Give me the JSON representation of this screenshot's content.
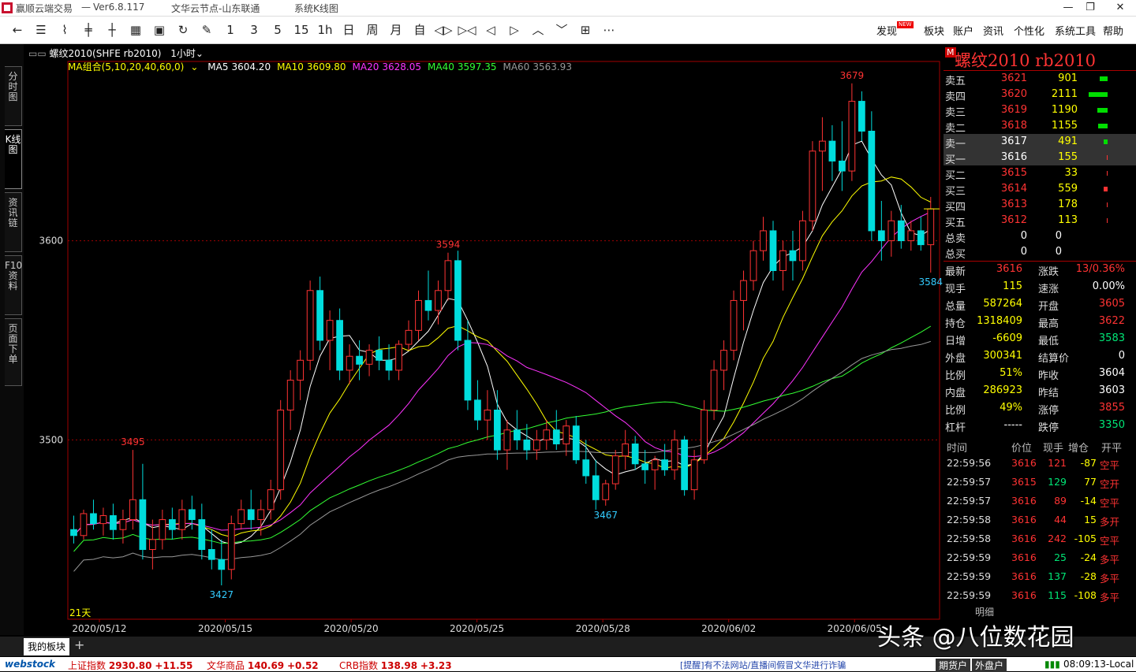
{
  "window": {
    "app_title": "赢顺云端交易",
    "version": "Ver6.8.117",
    "node": "文华云节点-山东联通",
    "chart_mode": "系统K线图",
    "buttons": {
      "minimize": "—",
      "restore": "❐",
      "close": "✕"
    }
  },
  "toolbar": {
    "icons": [
      "back-arrow-icon",
      "list-icon",
      "line-chart-icon",
      "candle-icon",
      "kline-icon",
      "table-icon",
      "save-icon",
      "refresh-icon",
      "draw-icon",
      "period-1",
      "period-3",
      "period-5",
      "period-15",
      "period-1h",
      "period-day",
      "period-week",
      "period-month",
      "custom-period",
      "zoom-in-icon",
      "zoom-out-icon",
      "left-icon",
      "right-icon",
      "up-icon",
      "down-icon",
      "layout-icon",
      "more-icon"
    ],
    "period_labels": [
      "1",
      "3",
      "5",
      "15",
      "1h",
      "日",
      "周",
      "月",
      "自"
    ],
    "more": "⋯",
    "menu": [
      "发现",
      "板块",
      "账户",
      "资讯",
      "个性化",
      "系统工具",
      "帮助"
    ],
    "new_badge": "NEW"
  },
  "side_tabs": [
    "分时图",
    "K线图",
    "资讯链",
    "F10资料",
    "页面下单"
  ],
  "chart_header": {
    "text": "螺纹2010(SHFE rb2010)",
    "period": "1小时",
    "ma_group_label": "MA组合(5,10,20,40,60,0)",
    "ma": [
      {
        "label": "MA5",
        "value": "3604.20",
        "color": "#ffffff"
      },
      {
        "label": "MA10",
        "value": "3609.80",
        "color": "#ffff00"
      },
      {
        "label": "MA20",
        "value": "3628.05",
        "color": "#ff33ff"
      },
      {
        "label": "MA40",
        "value": "3597.35",
        "color": "#33ff33"
      },
      {
        "label": "MA60",
        "value": "3563.93",
        "color": "#999999"
      }
    ],
    "days_label": "21天"
  },
  "chart_data": {
    "type": "candlestick",
    "ylim": [
      3410,
      3690
    ],
    "y_ticks": [
      3500,
      3600
    ],
    "x_ticks": [
      "2020/05/12",
      "2020/05/15",
      "2020/05/20",
      "2020/05/25",
      "2020/05/28",
      "2020/06/02",
      "2020/06/05"
    ],
    "annotations": [
      {
        "label": "3495",
        "value": 3495,
        "bar": 6
      },
      {
        "label": "3427",
        "value": 3427,
        "bar": 15
      },
      {
        "label": "3594",
        "value": 3594,
        "bar": 38
      },
      {
        "label": "3467",
        "value": 3467,
        "bar": 54
      },
      {
        "label": "3679",
        "value": 3679,
        "bar": 79
      },
      {
        "label": "3584",
        "value": 3584,
        "bar": 87
      }
    ],
    "candles": [
      [
        3455,
        3462,
        3448,
        3452
      ],
      [
        3452,
        3465,
        3450,
        3463
      ],
      [
        3463,
        3470,
        3455,
        3458
      ],
      [
        3458,
        3466,
        3452,
        3462
      ],
      [
        3462,
        3468,
        3450,
        3455
      ],
      [
        3455,
        3465,
        3448,
        3460
      ],
      [
        3460,
        3495,
        3455,
        3470
      ],
      [
        3470,
        3488,
        3440,
        3445
      ],
      [
        3445,
        3460,
        3435,
        3450
      ],
      [
        3450,
        3465,
        3445,
        3460
      ],
      [
        3460,
        3466,
        3450,
        3455
      ],
      [
        3455,
        3470,
        3450,
        3465
      ],
      [
        3465,
        3472,
        3455,
        3460
      ],
      [
        3460,
        3468,
        3440,
        3445
      ],
      [
        3445,
        3455,
        3435,
        3440
      ],
      [
        3440,
        3450,
        3427,
        3435
      ],
      [
        3435,
        3462,
        3430,
        3458
      ],
      [
        3458,
        3470,
        3455,
        3465
      ],
      [
        3465,
        3475,
        3455,
        3460
      ],
      [
        3460,
        3470,
        3452,
        3465
      ],
      [
        3465,
        3480,
        3460,
        3475
      ],
      [
        3475,
        3520,
        3470,
        3515
      ],
      [
        3515,
        3535,
        3505,
        3530
      ],
      [
        3530,
        3545,
        3520,
        3540
      ],
      [
        3540,
        3580,
        3535,
        3575
      ],
      [
        3575,
        3582,
        3545,
        3550
      ],
      [
        3550,
        3565,
        3535,
        3560
      ],
      [
        3560,
        3566,
        3530,
        3535
      ],
      [
        3535,
        3548,
        3528,
        3542
      ],
      [
        3542,
        3550,
        3530,
        3538
      ],
      [
        3538,
        3548,
        3532,
        3545
      ],
      [
        3545,
        3552,
        3535,
        3540
      ],
      [
        3540,
        3548,
        3530,
        3535
      ],
      [
        3535,
        3550,
        3530,
        3548
      ],
      [
        3548,
        3560,
        3545,
        3555
      ],
      [
        3555,
        3575,
        3550,
        3570
      ],
      [
        3570,
        3585,
        3560,
        3565
      ],
      [
        3565,
        3580,
        3558,
        3575
      ],
      [
        3575,
        3594,
        3570,
        3590
      ],
      [
        3590,
        3595,
        3545,
        3550
      ],
      [
        3550,
        3560,
        3515,
        3520
      ],
      [
        3520,
        3530,
        3505,
        3510
      ],
      [
        3510,
        3525,
        3500,
        3515
      ],
      [
        3515,
        3525,
        3490,
        3495
      ],
      [
        3495,
        3510,
        3485,
        3505
      ],
      [
        3505,
        3515,
        3495,
        3500
      ],
      [
        3500,
        3508,
        3490,
        3495
      ],
      [
        3495,
        3505,
        3490,
        3500
      ],
      [
        3500,
        3510,
        3495,
        3505
      ],
      [
        3505,
        3515,
        3495,
        3498
      ],
      [
        3498,
        3510,
        3492,
        3507
      ],
      [
        3507,
        3512,
        3488,
        3490
      ],
      [
        3490,
        3500,
        3478,
        3482
      ],
      [
        3482,
        3490,
        3465,
        3470
      ],
      [
        3470,
        3480,
        3467,
        3478
      ],
      [
        3478,
        3495,
        3475,
        3492
      ],
      [
        3492,
        3505,
        3485,
        3498
      ],
      [
        3498,
        3502,
        3485,
        3488
      ],
      [
        3488,
        3495,
        3478,
        3485
      ],
      [
        3485,
        3492,
        3475,
        3490
      ],
      [
        3490,
        3498,
        3482,
        3485
      ],
      [
        3485,
        3505,
        3480,
        3500
      ],
      [
        3500,
        3502,
        3472,
        3475
      ],
      [
        3475,
        3495,
        3470,
        3490
      ],
      [
        3490,
        3520,
        3488,
        3515
      ],
      [
        3515,
        3540,
        3510,
        3535
      ],
      [
        3535,
        3550,
        3525,
        3545
      ],
      [
        3545,
        3575,
        3540,
        3570
      ],
      [
        3570,
        3585,
        3555,
        3580
      ],
      [
        3580,
        3600,
        3575,
        3595
      ],
      [
        3595,
        3612,
        3590,
        3605
      ],
      [
        3605,
        3610,
        3580,
        3585
      ],
      [
        3585,
        3600,
        3575,
        3595
      ],
      [
        3595,
        3605,
        3580,
        3590
      ],
      [
        3590,
        3615,
        3585,
        3610
      ],
      [
        3610,
        3650,
        3605,
        3645
      ],
      [
        3645,
        3662,
        3625,
        3650
      ],
      [
        3650,
        3658,
        3630,
        3640
      ],
      [
        3640,
        3660,
        3625,
        3635
      ],
      [
        3635,
        3679,
        3630,
        3670
      ],
      [
        3670,
        3675,
        3650,
        3655
      ],
      [
        3655,
        3665,
        3600,
        3605
      ],
      [
        3605,
        3620,
        3590,
        3600
      ],
      [
        3600,
        3615,
        3592,
        3610
      ],
      [
        3610,
        3618,
        3596,
        3600
      ],
      [
        3600,
        3610,
        3595,
        3605
      ],
      [
        3605,
        3612,
        3595,
        3598
      ],
      [
        3598,
        3622,
        3584,
        3616
      ]
    ]
  },
  "quote": {
    "title": "螺纹2010  rb2010",
    "badge": "M",
    "orderbook": [
      {
        "label": "卖五",
        "price": "3621",
        "vol": "901",
        "bar": 10
      },
      {
        "label": "卖四",
        "price": "3620",
        "vol": "2111",
        "bar": 24
      },
      {
        "label": "卖三",
        "price": "3619",
        "vol": "1190",
        "bar": 13
      },
      {
        "label": "卖二",
        "price": "3618",
        "vol": "1155",
        "bar": 12
      },
      {
        "label": "卖一",
        "price": "3617",
        "vol": "491",
        "bar": 5
      },
      {
        "label": "买一",
        "price": "3616",
        "vol": "155",
        "bar": 1
      },
      {
        "label": "买二",
        "price": "3615",
        "vol": "33",
        "bar": 0
      },
      {
        "label": "买三",
        "price": "3614",
        "vol": "559",
        "bar": 5
      },
      {
        "label": "买四",
        "price": "3613",
        "vol": "178",
        "bar": 1
      },
      {
        "label": "买五",
        "price": "3612",
        "vol": "113",
        "bar": 1
      }
    ],
    "totals": [
      {
        "label": "总卖",
        "v1": "0",
        "v2": "0"
      },
      {
        "label": "总买",
        "v1": "0",
        "v2": "0"
      }
    ],
    "stats": [
      {
        "a": "最新",
        "b": "3616",
        "bc": "red",
        "c": "涨跌",
        "d": "13/0.36%",
        "dc": "red"
      },
      {
        "a": "现手",
        "b": "115",
        "bc": "yel",
        "c": "速涨",
        "d": "0.00%",
        "dc": "wht"
      },
      {
        "a": "总量",
        "b": "587264",
        "bc": "yel",
        "c": "开盘",
        "d": "3605",
        "dc": "red"
      },
      {
        "a": "持仓",
        "b": "1318409",
        "bc": "yel",
        "c": "最高",
        "d": "3622",
        "dc": "red"
      },
      {
        "a": "日增",
        "b": "-6609",
        "bc": "yel",
        "c": "最低",
        "d": "3583",
        "dc": "grn"
      },
      {
        "a": "外盘",
        "b": "300341",
        "bc": "yel",
        "c": "结算价",
        "d": "0",
        "dc": "wht"
      },
      {
        "a": "比例",
        "b": "51%",
        "bc": "yel",
        "c": "昨收",
        "d": "3604",
        "dc": "wht"
      },
      {
        "a": "内盘",
        "b": "286923",
        "bc": "yel",
        "c": "昨结",
        "d": "3603",
        "dc": "wht"
      },
      {
        "a": "比例",
        "b": "49%",
        "bc": "yel",
        "c": "涨停",
        "d": "3855",
        "dc": "red"
      },
      {
        "a": "杠杆",
        "b": "-----",
        "bc": "wht",
        "c": "跌停",
        "d": "3350",
        "dc": "grn"
      }
    ],
    "ticks_header": [
      "时间",
      "价位",
      "现手",
      "增仓",
      "开平"
    ],
    "ticks": [
      {
        "t": "22:59:56",
        "p": "3616",
        "q": "121",
        "qc": "red",
        "z": "-87",
        "o": "空平"
      },
      {
        "t": "22:59:57",
        "p": "3615",
        "q": "129",
        "qc": "grn",
        "z": "77",
        "o": "空开"
      },
      {
        "t": "22:59:57",
        "p": "3616",
        "q": "89",
        "qc": "red",
        "z": "-14",
        "o": "空平"
      },
      {
        "t": "22:59:58",
        "p": "3616",
        "q": "44",
        "qc": "red",
        "z": "15",
        "o": "多开"
      },
      {
        "t": "22:59:58",
        "p": "3616",
        "q": "242",
        "qc": "red",
        "z": "-105",
        "o": "空平"
      },
      {
        "t": "22:59:59",
        "p": "3616",
        "q": "25",
        "qc": "grn",
        "z": "-24",
        "o": "多平"
      },
      {
        "t": "22:59:59",
        "p": "3616",
        "q": "137",
        "qc": "grn",
        "z": "-28",
        "o": "多平"
      },
      {
        "t": "22:59:59",
        "p": "3616",
        "q": "115",
        "qc": "grn",
        "z": "-108",
        "o": "多平"
      }
    ],
    "bottom_tab": "明细"
  },
  "bottom": {
    "my_board": "我的板块",
    "plus": "+"
  },
  "status": {
    "brand": "webstock",
    "items": [
      {
        "name": "上证指数",
        "val": "2930.80",
        "chg": "+11.55"
      },
      {
        "name": "文华商品",
        "val": "140.69",
        "chg": "+0.52"
      },
      {
        "name": "CRB指数",
        "val": "138.98",
        "chg": "+3.23"
      }
    ],
    "marquee": "[提醒]有不法网站/直播间假冒文华进行诈骗",
    "tabs": [
      "期货户",
      "外盘户"
    ],
    "clock": "08:09:13-Local"
  },
  "watermark": "头条 @八位数花园"
}
